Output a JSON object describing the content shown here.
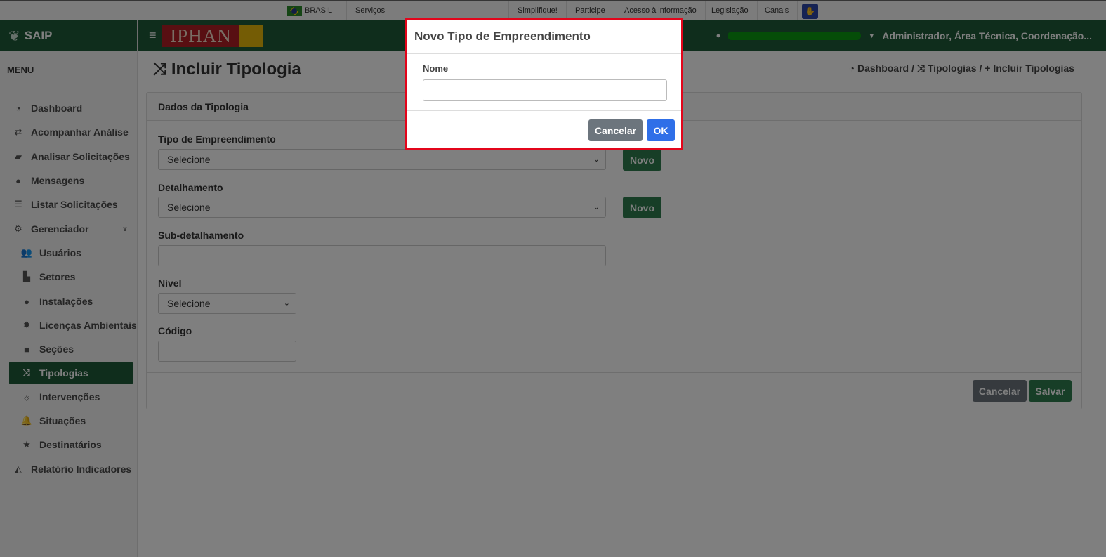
{
  "gov_bar": {
    "brasil": "BRASIL",
    "servicos": "Serviços",
    "links": [
      "Simplifique!",
      "Participe",
      "Acesso à informação",
      "Legislação",
      "Canais"
    ]
  },
  "brand": "SAIP",
  "menu_title": "MENU",
  "sidebar": {
    "items": [
      {
        "label": "Dashboard",
        "icon": "dashboard-icon"
      },
      {
        "label": "Acompanhar Análise",
        "icon": "exchange-icon"
      },
      {
        "label": "Analisar Solicitações",
        "icon": "book-icon"
      },
      {
        "label": "Mensagens",
        "icon": "chat-icon"
      },
      {
        "label": "Listar Solicitações",
        "icon": "list-icon"
      },
      {
        "label": "Gerenciador",
        "icon": "cogs-icon"
      },
      {
        "label": "Usuários",
        "icon": "users-icon"
      },
      {
        "label": "Setores",
        "icon": "industry-icon"
      },
      {
        "label": "Instalações",
        "icon": "circle-icon"
      },
      {
        "label": "Licenças Ambientais",
        "icon": "certificate-icon"
      },
      {
        "label": "Seções",
        "icon": "square-icon"
      },
      {
        "label": "Tipologias",
        "icon": "random-icon"
      },
      {
        "label": "Intervenções",
        "icon": "sun-icon"
      },
      {
        "label": "Situações",
        "icon": "bell-icon"
      },
      {
        "label": "Destinatários",
        "icon": "star-icon"
      },
      {
        "label": "Relatório Indicadores",
        "icon": "area-chart-icon"
      }
    ]
  },
  "header": {
    "logo_text": "IPHAN",
    "user_roles": "Administrador, Área Técnica, Coordenação..."
  },
  "page": {
    "title": "Incluir Tipologia",
    "breadcrumb": [
      "Dashboard",
      "Tipologias",
      "Incluir Tipologias"
    ]
  },
  "form": {
    "card_title": "Dados da Tipologia",
    "tipo_label": "Tipo de Empreendimento",
    "tipo_value": "Selecione",
    "detalhamento_label": "Detalhamento",
    "detalhamento_value": "Selecione",
    "subdetalhamento_label": "Sub-detalhamento",
    "nivel_label": "Nível",
    "nivel_value": "Selecione",
    "codigo_label": "Código",
    "novo_label": "Novo",
    "cancel_label": "Cancelar",
    "save_label": "Salvar"
  },
  "modal": {
    "title": "Novo Tipo de Empreendimento",
    "nome_label": "Nome",
    "cancel_label": "Cancelar",
    "ok_label": "OK"
  },
  "colors": {
    "primary_green": "#1e5a38",
    "modal_border": "#e3051b",
    "ok_blue": "#2f6fe8"
  }
}
